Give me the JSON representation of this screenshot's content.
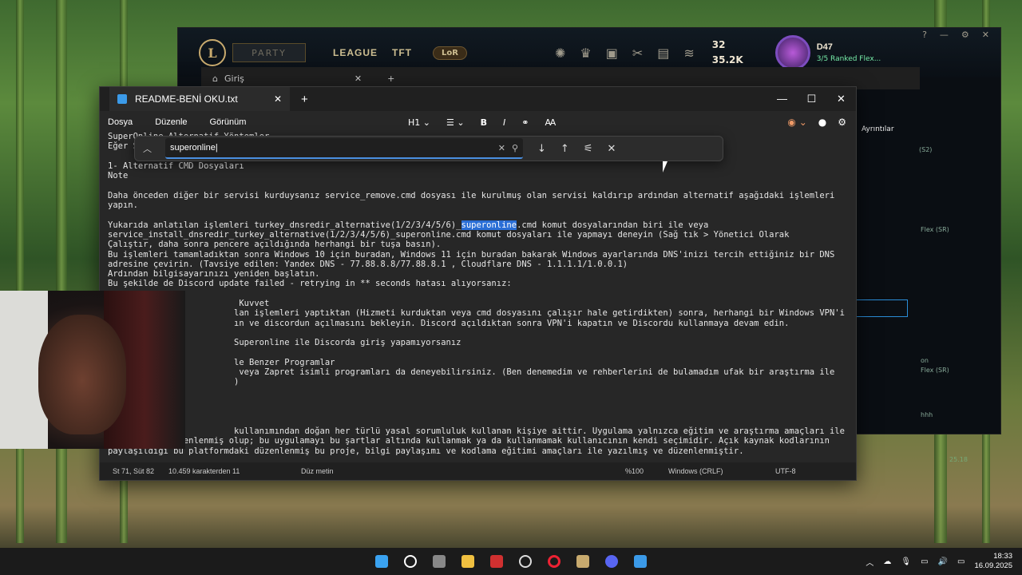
{
  "league": {
    "logo": "L",
    "party_label": "PARTY",
    "nav": [
      "LEAGUE",
      "TFT"
    ],
    "lor_label": "LoR",
    "rp": "32",
    "be": "35.2K",
    "profile_name": "D47",
    "profile_status": "3/5 Ranked Flex...",
    "side_details": "Ayrıntılar",
    "side_items": [
      "(S2)",
      "Flex (SR)",
      "Flex (SR)",
      "on",
      "hhh"
    ],
    "side_time": "25.18"
  },
  "behind_tab": "Giriş",
  "notepad": {
    "tab_title": "README-BENİ OKU.txt",
    "menu": [
      "Dosya",
      "Düzenle",
      "Görünüm"
    ],
    "format": {
      "heading": "H1",
      "bold": "B",
      "italic": "I"
    },
    "find": {
      "query": "superonline"
    },
    "lines": [
      "SuperOnline Alternatif Yöntemler",
      "Eğer SuperOnline Fiber k",
      "",
      "1- Alternatif CMD Dosyaları",
      "Note",
      "",
      "Daha önceden diğer bir servisi kurduysanız service_remove.cmd dosyası ile kurulmuş olan servisi kaldırıp ardından alternatif aşağıdaki işlemleri",
      "yapın.",
      "",
      "",
      "service_install_dnsredir_turkey_alternative(1/2/3/4/5/6)_superonline.cmd komut dosyaları ile yapmayı deneyin (Sağ tık > Yönetici Olarak",
      "Çalıştır, daha sonra pencere açıldığında herhangi bir tuşa basın).",
      "Bu işlemleri tamamladıktan sonra Windows 10 için buradan, Windows 11 için buradan bakarak Windows ayarlarında DNS'inizi tercih ettiğiniz bir DNS",
      "adresine çevirin. (Tavsiye edilen: Yandex DNS - 77.88.8.8/77.88.8.1 , Cloudflare DNS - 1.1.1.1/1.0.0.1)",
      "Ardından bilgisayarınızı yeniden başlatın.",
      "Bu şekilde de Discord update failed - retrying in ** seconds hatası alıyorsanız:",
      "",
      "                          Kuvvet",
      "                         lan işlemleri yaptıktan (Hizmeti kurduktan veya cmd dosyasını çalışır hale getirdikten) sonra, herhangi bir Windows VPN'i açıp",
      "                         ın ve discordun açılmasını bekleyin. Discord açıldıktan sonra VPN'i kapatın ve Discordu kullanmaya devam edin.",
      "",
      "                         Superonline ile Discorda giriş yapamıyorsanız",
      "",
      "                         le Benzer Programlar",
      "                          veya Zapret isimli programları da deneyebilirsiniz. (Ben denemedim ve rehberlerini de bulamadım ufak bir araştırma ile",
      "                         )",
      "",
      "",
      "",
      "",
      "                         kullanımından doğan her türlü yasal sorumluluk kullanan kişiye aittir. Uygulama yalnızca eğitim ve araştırma amaçları ile",
      "yazılmış ve düzenlenmiş olup; bu uygulamayı bu şartlar altında kullanmak ya da kullanmamak kullanıcının kendi seçimidir. Açık kaynak kodlarının",
      "paylaşıldığı bu platformdaki düzenlenmiş bu proje, bilgi paylaşımı ve kodlama eğitimi amaçları ile yazılmış ve düzenlenmiştir."
    ],
    "hl_line": {
      "pre": "Yukarıda anlatılan işlemleri turkey_dnsredir_alternative(1/2/3/4/5/6)_",
      "match": "superonline",
      "post": ".cmd komut dosyalarından biri ile veya"
    },
    "status": {
      "pos": "St 71, Süt 82",
      "chars": "10.459 karakterden 11",
      "type": "Düz metin",
      "zoom": "%100",
      "eol": "Windows (CRLF)",
      "enc": "UTF-8"
    }
  },
  "clock": {
    "time": "18:33",
    "date": "16.09.2025"
  }
}
